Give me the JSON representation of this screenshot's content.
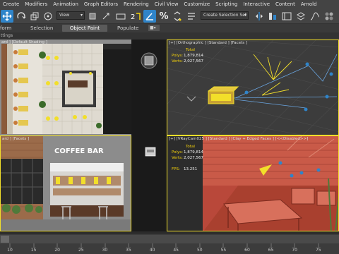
{
  "menu": [
    "Create",
    "Modifiers",
    "Animation",
    "Graph Editors",
    "Rendering",
    "Civil View",
    "Customize",
    "Scripting",
    "Interactive",
    "Content",
    "Arnold"
  ],
  "toolbar": {
    "view_dropdown": "View",
    "selection_set": "Create Selection Set"
  },
  "ribbon": {
    "tabs": [
      "form",
      "Selection",
      "Object Paint",
      "Populate"
    ],
    "active_tab": "Object Paint"
  },
  "subbar": {
    "label": "ttings"
  },
  "viewports": {
    "top_left": {
      "label": "ard ] [Default Shading ]"
    },
    "top_right": {
      "label": "[+] [Orthographic ] [Standard ] [Facets ]",
      "stats_title": "Total",
      "polys_label": "Polys:",
      "polys": "1,879,814",
      "verts_label": "Verts:",
      "verts": "2,027,567"
    },
    "bottom_left": {
      "label": "ard ] [Facets ]",
      "sign": "COFFEE BAR"
    },
    "bottom_right": {
      "label": "[+] [VRayCam025 ] [Standard ] [Clay + Edged Faces ] [<<Disabled>>]",
      "stats_title": "Total",
      "polys_label": "Polys:",
      "polys": "1,879,814",
      "verts_label": "Verts:",
      "verts": "2,027,567",
      "fps_label": "FPS:",
      "fps": "13.251"
    }
  },
  "timeline": {
    "ticks": [
      "10",
      "15",
      "20",
      "25",
      "30",
      "35",
      "40",
      "45",
      "50",
      "55",
      "60",
      "65",
      "70",
      "75",
      "80"
    ],
    "progress_label": ""
  },
  "colors": {
    "accent": "#2f84c9",
    "stats": "#f5d20a",
    "wireframe": "#f2df2a",
    "clay": "#d6624e"
  }
}
